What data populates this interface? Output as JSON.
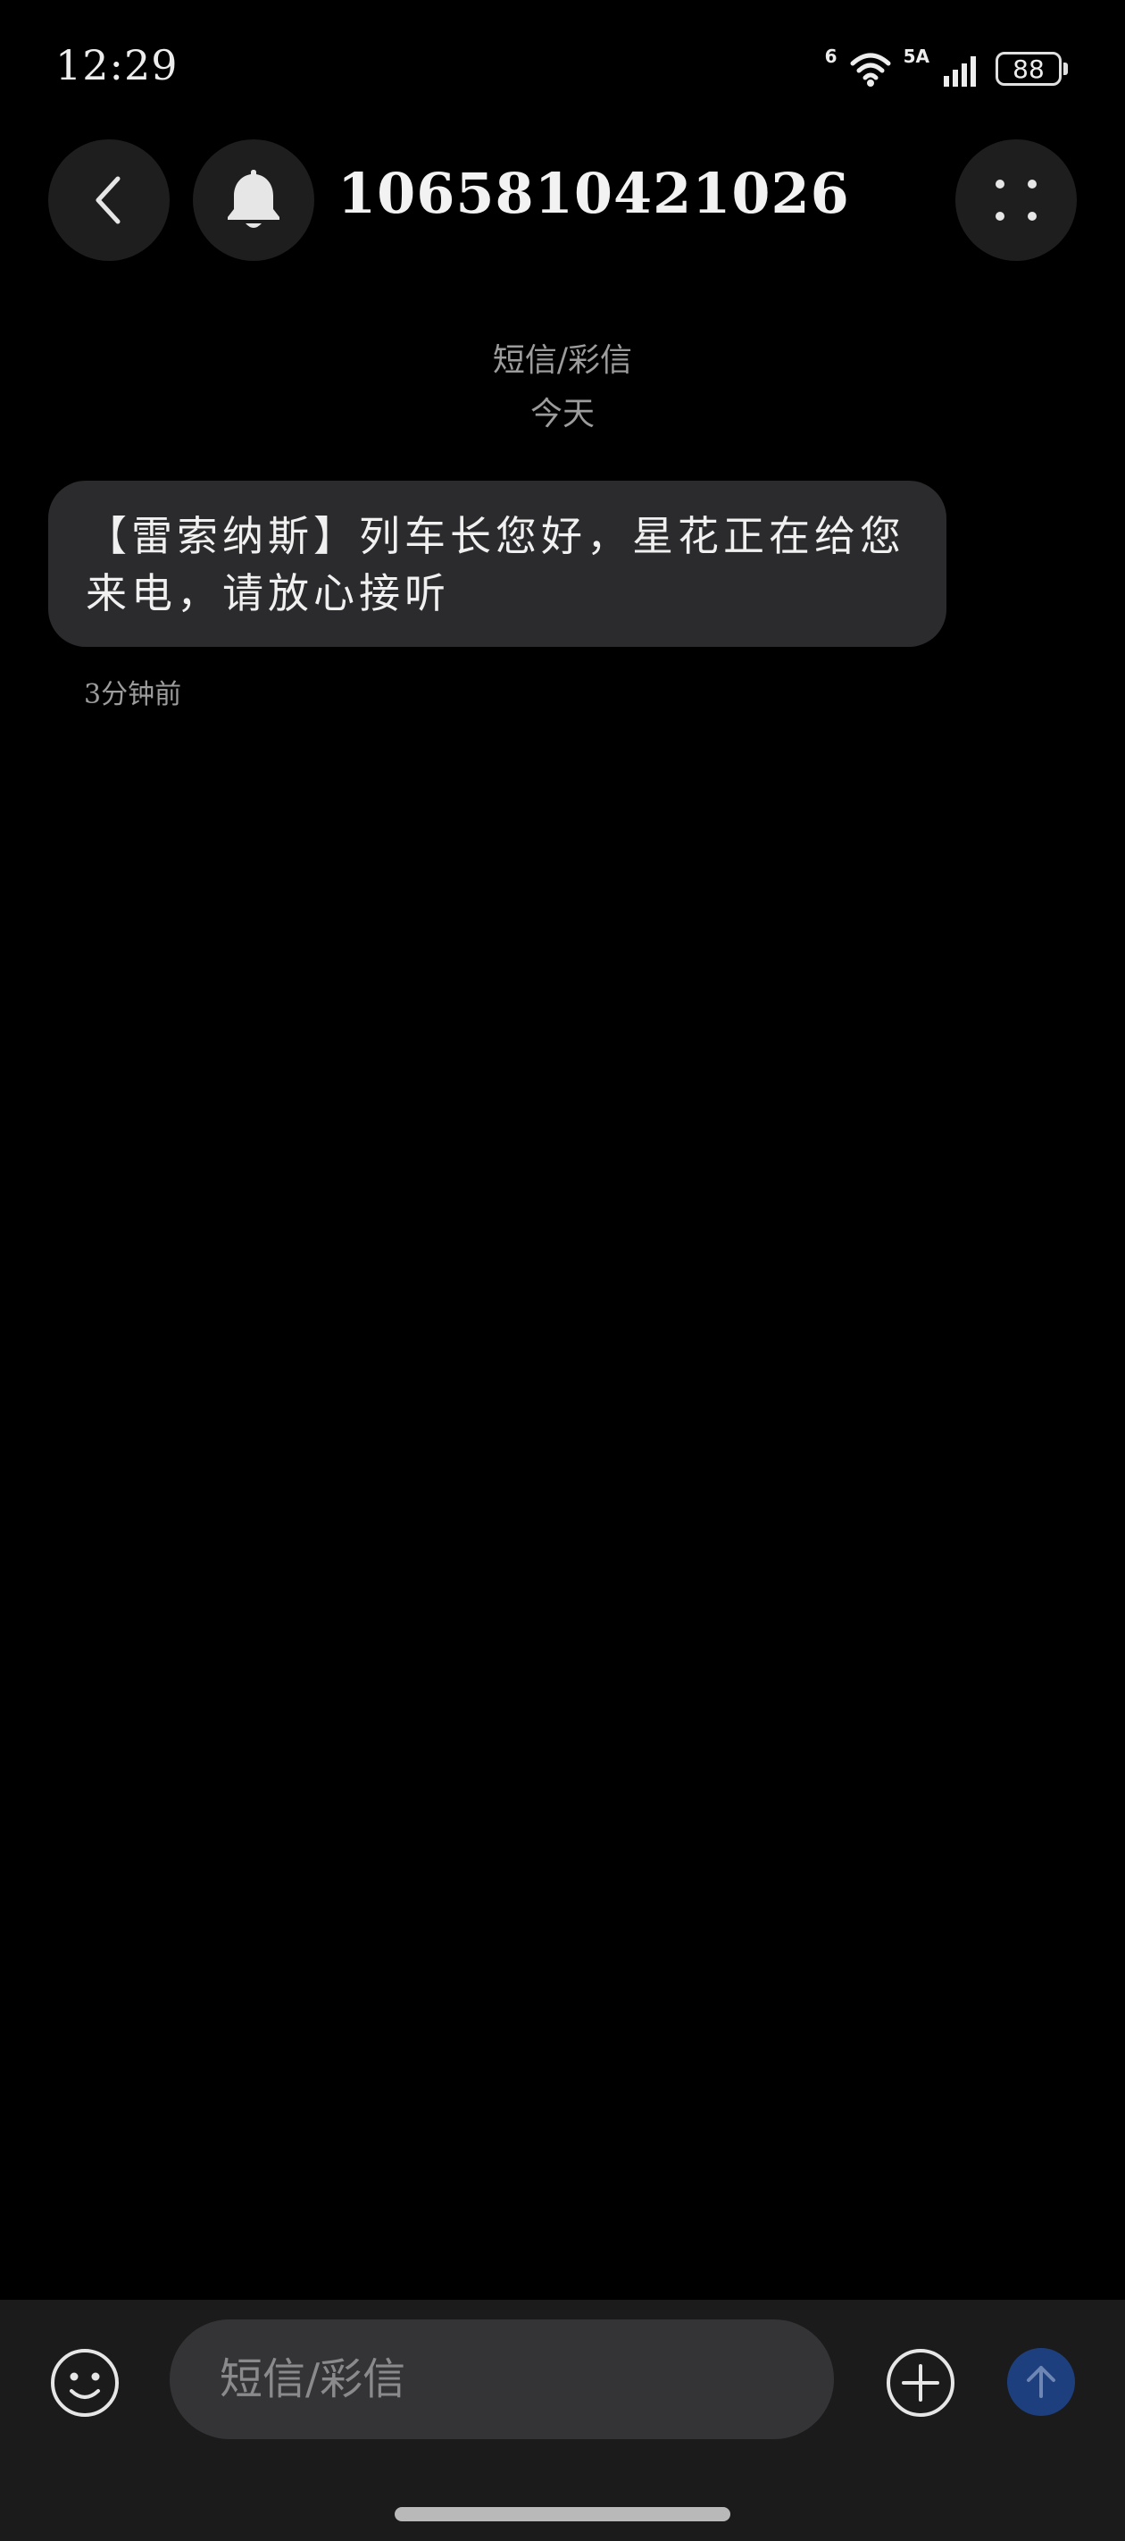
{
  "status_bar": {
    "time": "12:29",
    "wifi_label": "6",
    "network_label": "5A",
    "battery": "88"
  },
  "header": {
    "title": "1065810421026"
  },
  "conversation": {
    "message_type": "短信/彩信",
    "date_label": "今天",
    "messages": [
      {
        "text": "【雷索纳斯】列车长您好，星花正在给您来电，请放心接听",
        "time": "3分钟前"
      }
    ]
  },
  "input_bar": {
    "placeholder": "短信/彩信"
  },
  "colors": {
    "background": "#000000",
    "bubble": "#2b2b2d",
    "send_button": "#1e3f7d"
  },
  "icons": {
    "back": "chevron-left-icon",
    "bell": "bell-icon",
    "more": "more-dots-icon",
    "emoji": "emoji-icon",
    "add": "plus-circle-icon",
    "send": "arrow-up-icon"
  }
}
